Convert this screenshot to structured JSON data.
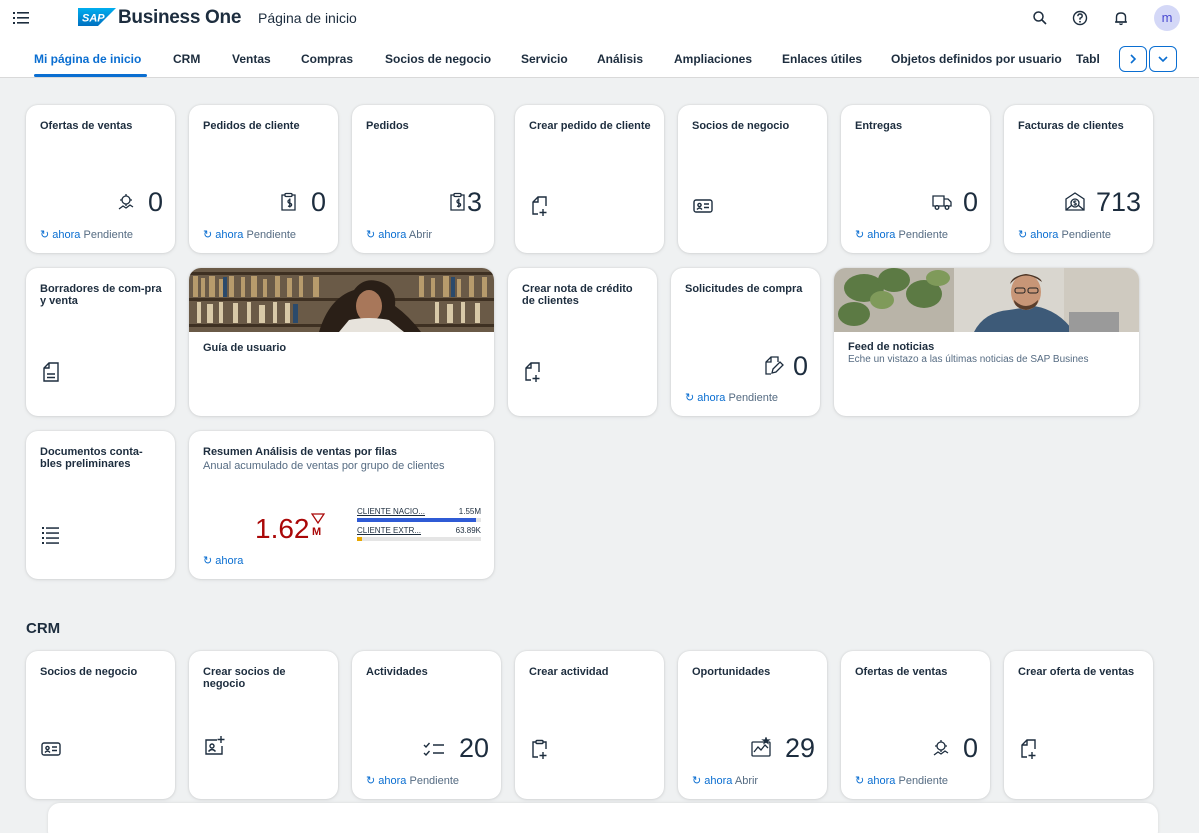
{
  "shell": {
    "brand": "Business One",
    "logo_text": "SAP",
    "page_title": "Página de inicio",
    "avatar_initial": "m"
  },
  "tabs": [
    "Mi página de inicio",
    "CRM",
    "Ventas",
    "Compras",
    "Socios de negocio",
    "Servicio",
    "Análisis",
    "Ampliaciones",
    "Enlaces útiles",
    "Objetos definidos por usuario",
    "Tabl"
  ],
  "tiles": {
    "ofertas": {
      "title": "Ofertas de ventas",
      "value": "0",
      "refresh": "ahora",
      "status": "Pendiente",
      "icon": "sales-quote-icon"
    },
    "pedidos_cliente": {
      "title": "Pedidos de cliente",
      "value": "0",
      "refresh": "ahora",
      "status": "Pendiente",
      "icon": "clipboard-dollar-icon"
    },
    "pedidos": {
      "title": "Pedidos",
      "value": "3",
      "refresh": "ahora",
      "status": "Abrir",
      "icon": "clipboard-dollar-icon"
    },
    "crear_pedido": {
      "title": "Crear pedido de cliente",
      "icon": "document-add-icon"
    },
    "socios": {
      "title": "Socios de negocio",
      "icon": "business-card-icon"
    },
    "entregas": {
      "title": "Entregas",
      "value": "0",
      "refresh": "ahora",
      "status": "Pendiente",
      "icon": "truck-icon"
    },
    "facturas": {
      "title": "Facturas de clientes",
      "value": "713",
      "refresh": "ahora",
      "status": "Pendiente",
      "icon": "invoice-icon"
    },
    "borradores": {
      "title": "Borradores de com-pra y venta",
      "icon": "draft-document-icon"
    },
    "guia": {
      "title": "Guía de usuario"
    },
    "nota_credito": {
      "title": "Crear nota de crédito de clientes",
      "icon": "document-add-icon"
    },
    "solicitudes": {
      "title": "Solicitudes de compra",
      "value": "0",
      "refresh": "ahora",
      "status": "Pendiente",
      "icon": "edit-document-icon"
    },
    "feed": {
      "title": "Feed de noticias",
      "subtitle": "Eche un vistazo a las últimas noticias de SAP Busines"
    },
    "documentos": {
      "title": "Documentos conta-bles preliminares",
      "icon": "list-icon"
    },
    "resumen": {
      "title": "Resumen Análisis de ventas por filas",
      "subtitle": "Anual acumulado de ventas por grupo de clientes",
      "value": "1.62",
      "unit": "M",
      "refresh": "ahora",
      "bars": [
        {
          "label": "CLIENTE NACIO...",
          "value": "1.55M",
          "fraction": 0.96,
          "color": "#2f5bd5"
        },
        {
          "label": "CLIENTE EXTR...",
          "value": "63.89K",
          "fraction": 0.04,
          "color": "#e9a800"
        }
      ]
    }
  },
  "crm": {
    "section_title": "CRM",
    "tiles": {
      "socios": {
        "title": "Socios de negocio",
        "icon": "business-card-icon"
      },
      "crear_socios": {
        "title": "Crear socios de negocio",
        "icon": "add-contact-icon"
      },
      "actividades": {
        "title": "Actividades",
        "value": "20",
        "refresh": "ahora",
        "status": "Pendiente",
        "icon": "task-list-icon"
      },
      "crear_actividad": {
        "title": "Crear actividad",
        "icon": "clipboard-add-icon"
      },
      "oportunidades": {
        "title": "Oportunidades",
        "value": "29",
        "refresh": "ahora",
        "status": "Abrir",
        "icon": "opportunity-icon"
      },
      "ofertas": {
        "title": "Ofertas de ventas",
        "value": "0",
        "refresh": "ahora",
        "status": "Pendiente",
        "icon": "sales-quote-icon"
      },
      "crear_oferta": {
        "title": "Crear oferta de ventas",
        "icon": "document-add-icon"
      }
    }
  },
  "colors": {
    "accent": "#0a6ed1",
    "negative": "#aa0808",
    "background": "#eff1f2"
  }
}
